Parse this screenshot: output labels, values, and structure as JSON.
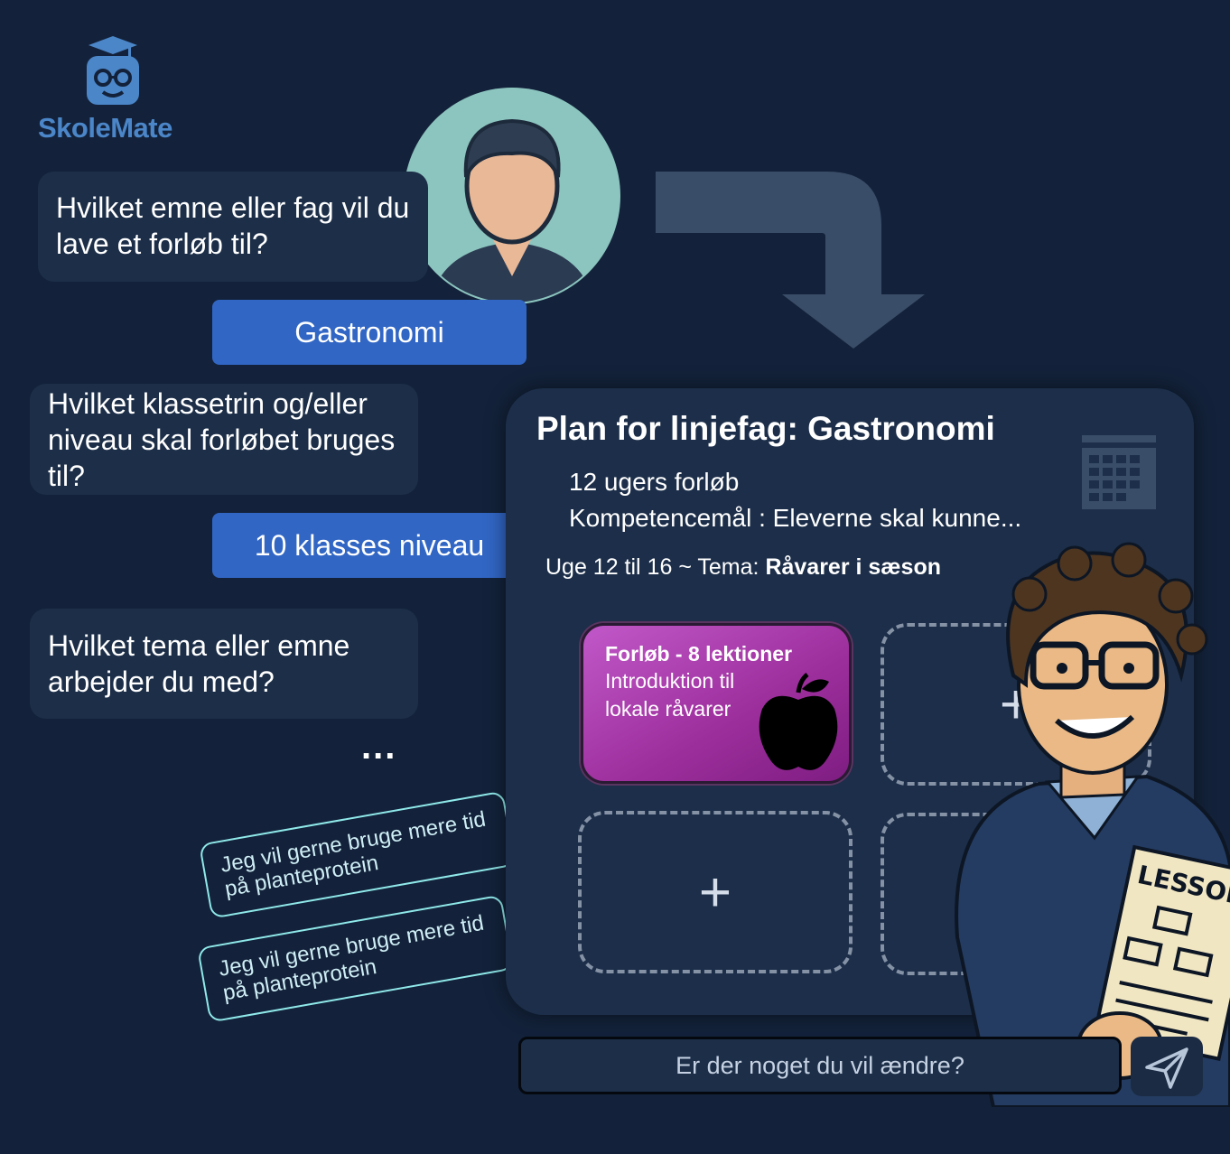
{
  "app": {
    "name": "SkoleMate"
  },
  "chat": {
    "q1": "Hvilket emne eller fag vil du lave et forløb til?",
    "a1": "Gastronomi",
    "q2": "Hvilket klassetrin og/eller niveau skal forløbet bruges til?",
    "a2": "10 klasses niveau",
    "q3": "Hvilket tema eller emne arbejder du med?",
    "typing": "...",
    "notes": [
      "Jeg vil gerne bruge mere tid på planteprotein",
      "Jeg vil gerne bruge mere tid på planteprotein"
    ]
  },
  "plan": {
    "title": "Plan for linjefag: Gastronomi",
    "duration": "12 ugers forløb",
    "goal": "Kompetencemål : Eleverne skal kunne...",
    "week_prefix": "Uge 12 til 16 ~ Tema: ",
    "week_theme": "Råvarer i sæson",
    "lesson": {
      "title": "Forløb - 8 lektioner",
      "description": "Introduktion til lokale råvarer"
    },
    "add_symbol": "+",
    "illustration_label": "LESSON"
  },
  "input": {
    "placeholder": "Er der noget du vil ændre?"
  },
  "colors": {
    "background": "#13223a",
    "bubble": "#1c2e48",
    "answer": "#3166c4",
    "lesson": "#b046b8",
    "note_border": "#8fe9ea"
  }
}
